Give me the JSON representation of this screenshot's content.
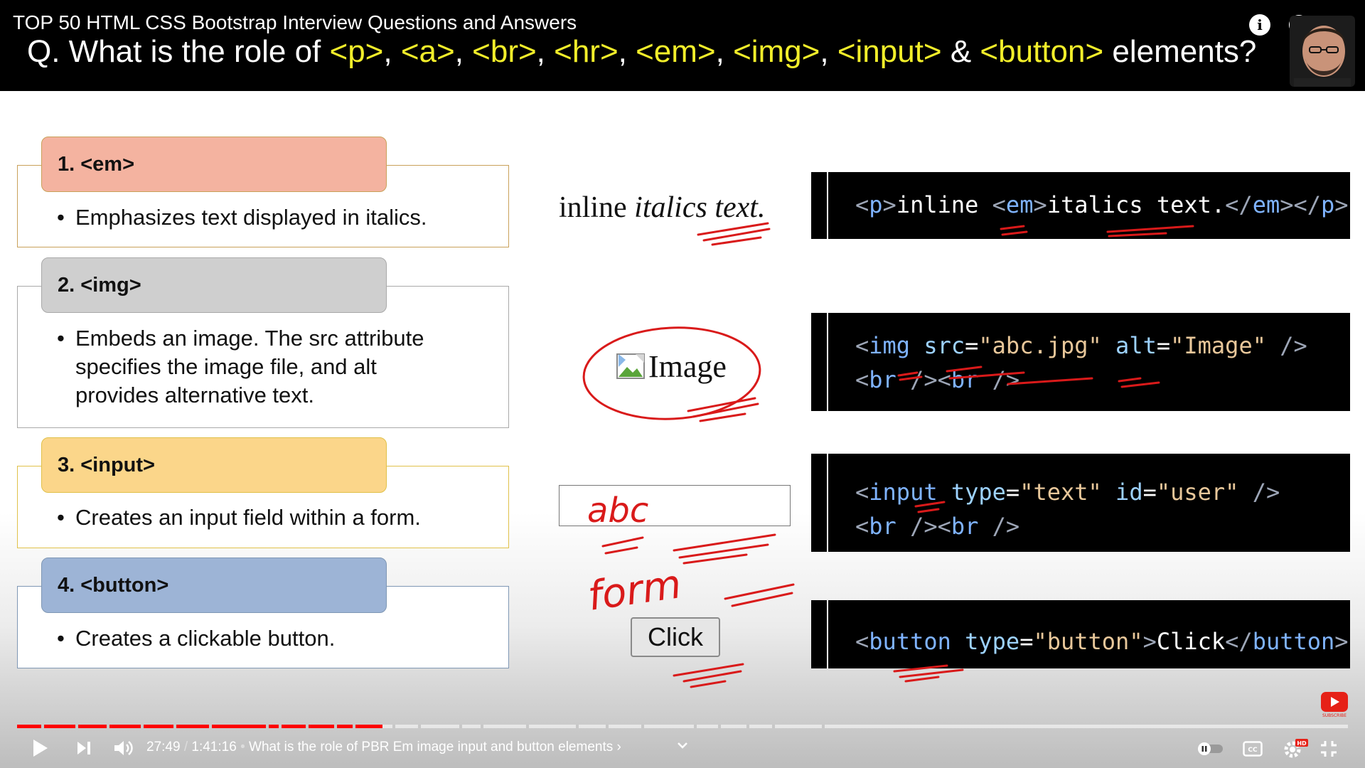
{
  "header": {
    "series_title": "TOP 50 HTML CSS Bootstrap Interview Questions and Answers",
    "question_prefix": "Q. What is the role of ",
    "question_tags": [
      "<p>",
      "<a>",
      "<br>",
      "<hr>",
      "<em>",
      "<img>",
      "<input>"
    ],
    "question_and": " & ",
    "question_last_tag": "<button>",
    "question_suffix": " elements?",
    "tag_color": "#f2ee2a"
  },
  "cards": [
    {
      "title": "1. <em>",
      "bullet": "Emphasizes text displayed in italics.",
      "head_color": "#f4b3a0",
      "border_color": "#c9a15a"
    },
    {
      "title": "2. <img>",
      "bullet": "Embeds an image. The src attribute specifies the image file, and alt provides alternative text.",
      "head_color": "#cfcfcf",
      "border_color": "#a9a9a9"
    },
    {
      "title": "3. <input>",
      "bullet": "Creates an input field within a form.",
      "head_color": "#fbd68a",
      "border_color": "#e0c14a"
    },
    {
      "title": "4. <button>",
      "bullet": "Creates a clickable button.",
      "head_color": "#9db4d6",
      "border_color": "#7f97b4"
    }
  ],
  "previews": {
    "inline_normal": "inline ",
    "inline_italic": "italics text.",
    "image_alt": "Image",
    "input_value": "",
    "button_label": "Click"
  },
  "handwriting": {
    "input_note": "abc",
    "form_note": "form"
  },
  "code_blocks": [
    {
      "lines": [
        [
          [
            "c-br",
            "<"
          ],
          [
            "c-tag",
            "p"
          ],
          [
            "c-br",
            ">"
          ],
          [
            "c-txt",
            "inline "
          ],
          [
            "c-br",
            "<"
          ],
          [
            "c-tag",
            "em"
          ],
          [
            "c-br",
            ">"
          ],
          [
            "c-txt",
            "italics text."
          ],
          [
            "c-br",
            "</"
          ],
          [
            "c-tag",
            "em"
          ],
          [
            "c-br",
            "></"
          ],
          [
            "c-tag",
            "p"
          ],
          [
            "c-br",
            ">"
          ]
        ]
      ]
    },
    {
      "lines": [
        [
          [
            "c-br",
            "<"
          ],
          [
            "c-tag",
            "img"
          ],
          [
            "c-txt",
            " "
          ],
          [
            "c-attr",
            "src"
          ],
          [
            "c-txt",
            "="
          ],
          [
            "c-str",
            "\"abc.jpg\""
          ],
          [
            "c-txt",
            " "
          ],
          [
            "c-attr",
            "alt"
          ],
          [
            "c-txt",
            "="
          ],
          [
            "c-str",
            "\"Image\""
          ],
          [
            "c-txt",
            " "
          ],
          [
            "c-br",
            "/>"
          ]
        ],
        [
          [
            "c-br",
            "<"
          ],
          [
            "c-tag",
            "br"
          ],
          [
            "c-txt",
            " "
          ],
          [
            "c-br",
            "/><"
          ],
          [
            "c-tag",
            "br"
          ],
          [
            "c-txt",
            " "
          ],
          [
            "c-br",
            "/>"
          ]
        ]
      ]
    },
    {
      "lines": [
        [
          [
            "c-br",
            "<"
          ],
          [
            "c-tag",
            "input"
          ],
          [
            "c-txt",
            " "
          ],
          [
            "c-attr",
            "type"
          ],
          [
            "c-txt",
            "="
          ],
          [
            "c-str",
            "\"text\""
          ],
          [
            "c-txt",
            " "
          ],
          [
            "c-attr",
            "id"
          ],
          [
            "c-txt",
            "="
          ],
          [
            "c-str",
            "\"user\""
          ],
          [
            "c-txt",
            " "
          ],
          [
            "c-br",
            "/>"
          ]
        ],
        [
          [
            "c-br",
            "<"
          ],
          [
            "c-tag",
            "br"
          ],
          [
            "c-txt",
            " "
          ],
          [
            "c-br",
            "/><"
          ],
          [
            "c-tag",
            "br"
          ],
          [
            "c-txt",
            " "
          ],
          [
            "c-br",
            "/>"
          ]
        ]
      ]
    },
    {
      "lines": [
        [
          [
            "c-br",
            "<"
          ],
          [
            "c-tag",
            "button"
          ],
          [
            "c-txt",
            " "
          ],
          [
            "c-attr",
            "type"
          ],
          [
            "c-txt",
            "="
          ],
          [
            "c-str",
            "\"button\""
          ],
          [
            "c-br",
            ">"
          ],
          [
            "c-txt",
            "Click"
          ],
          [
            "c-br",
            "</"
          ],
          [
            "c-tag",
            "button"
          ],
          [
            "c-br",
            ">"
          ]
        ]
      ]
    }
  ],
  "player": {
    "current_time": "27:49",
    "duration": "1:41:16",
    "separator": " / ",
    "chapter_title": "What is the role of PBR Em image input and button elements",
    "progress_fraction": 0.2746,
    "buffer_fraction": 0.2455,
    "accent_color": "#ff0000",
    "hd_badge": "HD",
    "cc_label": "CC",
    "subscribe_label": "SUBSCRIBE"
  }
}
